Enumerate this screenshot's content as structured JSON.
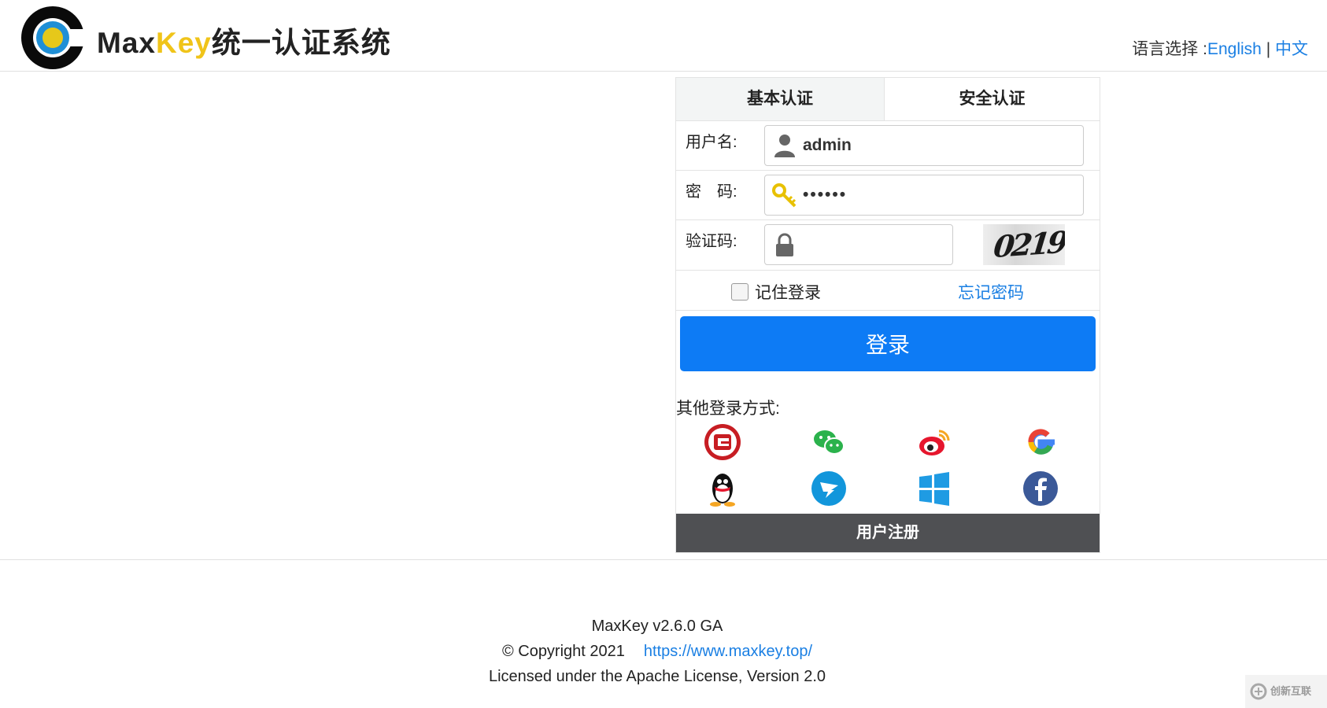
{
  "header": {
    "logo_prefix": "Max",
    "logo_key": "Key",
    "logo_suffix": "统一认证系统",
    "language_label": "语言选择 :",
    "language_english": "English",
    "language_separator": "|",
    "language_chinese": "中文"
  },
  "login": {
    "tabs": [
      "基本认证",
      "安全认证"
    ],
    "username_label": "用户名:",
    "username_value": "admin",
    "password_label": "密　码:",
    "password_value": "••••••",
    "captcha_label": "验证码:",
    "captcha_value": "",
    "captcha_text": "0219",
    "remember_label": "记住登录",
    "forgot_label": "忘记密码",
    "login_button": "登录",
    "other_login_label": "其他登录方式:",
    "register_label": "用户注册"
  },
  "social_icons": [
    "gitee-icon",
    "wechat-icon",
    "weibo-icon",
    "google-icon",
    "qq-icon",
    "dingtalk-icon",
    "windows-icon",
    "facebook-icon"
  ],
  "footer": {
    "version": "MaxKey  v2.6.0 GA",
    "copyright": "© Copyright 2021",
    "website": "https://www.maxkey.top/",
    "license": "Licensed under the Apache License, Version 2.0"
  },
  "watermark": {
    "text": "创新互联"
  },
  "colors": {
    "accent": "#0d7bf5",
    "link": "#1a7fe3",
    "logo_yellow": "#f0c419",
    "register_bg": "#4f5053"
  }
}
